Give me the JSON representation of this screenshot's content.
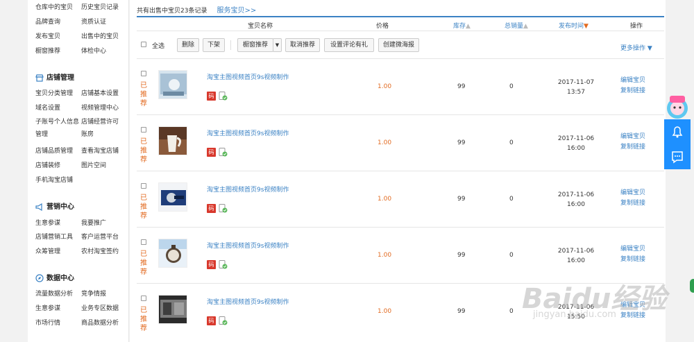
{
  "sidebar": {
    "top_items": [
      [
        "仓库中的宝贝",
        "历史宝贝记录"
      ],
      [
        "品牌查询",
        "资质认证"
      ],
      [
        "发布宝贝",
        "出售中的宝贝"
      ],
      [
        "橱窗推荐",
        "体检中心"
      ]
    ],
    "store_title": "店铺管理",
    "store_items": [
      [
        "宝贝分类管理",
        "店铺基本设置"
      ],
      [
        "域名设置",
        "视频管理中心"
      ],
      [
        "子账号个人信息",
        "店铺经营许可"
      ],
      [
        "管理",
        "账房"
      ],
      [
        "店铺品质管理",
        "查看淘宝店铺"
      ],
      [
        "店铺装修",
        "图片空间"
      ],
      [
        "手机淘宝店铺",
        ""
      ]
    ],
    "marketing_title": "营销中心",
    "marketing_items": [
      [
        "生意参谋",
        "我要推广"
      ],
      [
        "店铺营销工具",
        "客户运营平台"
      ],
      [
        "众筹管理",
        "农村淘宝签约"
      ]
    ],
    "data_title": "数据中心",
    "data_items": [
      [
        "流量数据分析",
        "竞争情报"
      ],
      [
        "生意参谋",
        "业务专区数据"
      ],
      [
        "市场行情",
        "商品数据分析"
      ]
    ]
  },
  "main": {
    "summary": "共有出售中宝贝23条记录",
    "service_link": "服务宝贝>>",
    "columns": {
      "name": "宝贝名称",
      "price": "价格",
      "stock": "库存",
      "sales": "总销量",
      "date": "发布时间",
      "ops": "操作"
    },
    "toolbar": {
      "select_all": "全选",
      "delete": "删除",
      "delist": "下架",
      "window_recommend": "橱窗推荐",
      "cancel_recommend": "取消推荐",
      "set_review_gift": "设置评论有礼",
      "create_weitao": "创建微海报",
      "more_ops": "更多操作"
    },
    "rows": [
      {
        "recommend": "已推荐",
        "title": "淘宝主图视频首页9s视频制作",
        "price": "1.00",
        "stock": "99",
        "sales": "0",
        "date": "2017-11-07",
        "time": "13:57",
        "edit": "编辑宝贝",
        "copy": "复制链接",
        "code": "码"
      },
      {
        "recommend": "已推荐",
        "title": "淘宝主图视频首页9s视频制作",
        "price": "1.00",
        "stock": "99",
        "sales": "0",
        "date": "2017-11-06",
        "time": "16:00",
        "edit": "编辑宝贝",
        "copy": "复制链接",
        "code": "码"
      },
      {
        "recommend": "已推荐",
        "title": "淘宝主图视频首页9s视频制作",
        "price": "1.00",
        "stock": "99",
        "sales": "0",
        "date": "2017-11-06",
        "time": "16:00",
        "edit": "编辑宝贝",
        "copy": "复制链接",
        "code": "码"
      },
      {
        "recommend": "已推荐",
        "title": "淘宝主图视频首页9s视频制作",
        "price": "1.00",
        "stock": "99",
        "sales": "0",
        "date": "2017-11-06",
        "time": "16:00",
        "edit": "编辑宝贝",
        "copy": "复制链接",
        "code": "码"
      },
      {
        "recommend": "已推荐",
        "title": "淘宝主图视频首页9s视频制作",
        "price": "1.00",
        "stock": "99",
        "sales": "0",
        "date": "2017-11-06",
        "time": "15:50",
        "edit": "编辑宝贝",
        "copy": "复制链接",
        "code": "码"
      }
    ]
  },
  "watermark": {
    "brand": "Baidu经验",
    "url": "jingyan.baidu.com"
  },
  "colors": {
    "link": "#3b82c4",
    "accent_orange": "#e26a20",
    "side_blue": "#1e90ff",
    "code_red": "#d8382c"
  }
}
